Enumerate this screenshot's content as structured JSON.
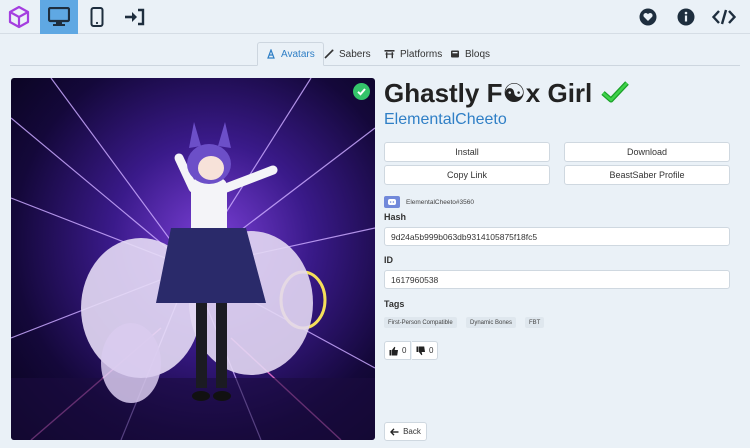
{
  "topbar": {
    "nav": [
      {
        "icon": "cube-logo-icon"
      },
      {
        "icon": "desktop-icon",
        "active": true
      },
      {
        "icon": "mobile-icon"
      },
      {
        "icon": "sign-in-icon"
      }
    ],
    "right": [
      {
        "icon": "heart-icon"
      },
      {
        "icon": "info-icon"
      },
      {
        "icon": "code-icon"
      }
    ]
  },
  "tabs": [
    {
      "label": "Avatars",
      "icon": "avatar-icon",
      "active": true
    },
    {
      "label": "Sabers",
      "icon": "saber-icon"
    },
    {
      "label": "Platforms",
      "icon": "platform-icon"
    },
    {
      "label": "Bloqs",
      "icon": "bloq-icon"
    }
  ],
  "item": {
    "title": "Ghastly F☯x Girl",
    "author": "ElementalCheeto",
    "discord": "ElementalCheeto#3560",
    "hash_label": "Hash",
    "hash": "9d24a5b999b063db9314105875f18fc5",
    "id_label": "ID",
    "id": "1617960538",
    "tags_label": "Tags",
    "tags": [
      "First-Person Compatible",
      "Dynamic Bones",
      "FBT"
    ],
    "upvotes": "0",
    "downvotes": "0"
  },
  "buttons": {
    "install": "Install",
    "download": "Download",
    "copy_link": "Copy Link",
    "beastsaber": "BeastSaber Profile",
    "back": "Back"
  },
  "colors": {
    "accent": "#2f7fc6",
    "active_nav": "#5fa8e3",
    "success": "#34c46a",
    "discord": "#7289da"
  }
}
